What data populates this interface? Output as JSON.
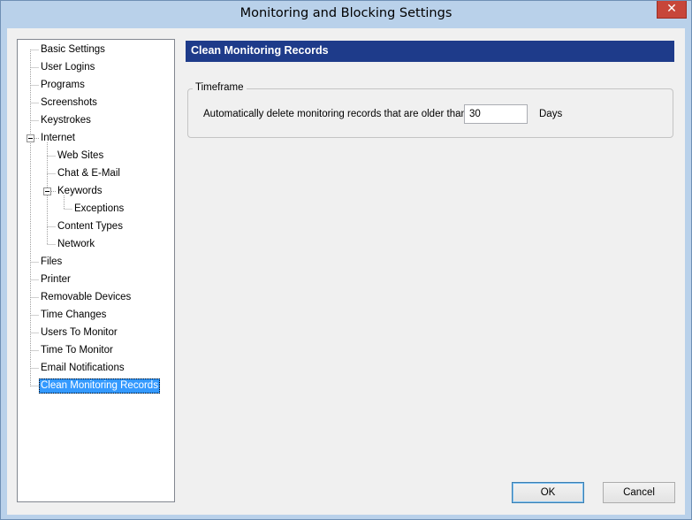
{
  "window": {
    "title": "Monitoring and Blocking Settings",
    "close_glyph": "✕"
  },
  "tree": [
    {
      "label": "Basic Settings",
      "name": "tree-item-basic-settings"
    },
    {
      "label": "User Logins",
      "name": "tree-item-user-logins"
    },
    {
      "label": "Programs",
      "name": "tree-item-programs"
    },
    {
      "label": "Screenshots",
      "name": "tree-item-screenshots"
    },
    {
      "label": "Keystrokes",
      "name": "tree-item-keystrokes"
    },
    {
      "label": "Internet",
      "name": "tree-item-internet",
      "expanded": true
    },
    {
      "label": "Web Sites",
      "name": "tree-item-web-sites"
    },
    {
      "label": "Chat & E-Mail",
      "name": "tree-item-chat-email"
    },
    {
      "label": "Keywords",
      "name": "tree-item-keywords",
      "expanded": true
    },
    {
      "label": "Exceptions",
      "name": "tree-item-exceptions"
    },
    {
      "label": "Content Types",
      "name": "tree-item-content-types"
    },
    {
      "label": "Network",
      "name": "tree-item-network"
    },
    {
      "label": "Files",
      "name": "tree-item-files"
    },
    {
      "label": "Printer",
      "name": "tree-item-printer"
    },
    {
      "label": "Removable Devices",
      "name": "tree-item-removable-devices"
    },
    {
      "label": "Time Changes",
      "name": "tree-item-time-changes"
    },
    {
      "label": "Users To Monitor",
      "name": "tree-item-users-to-monitor"
    },
    {
      "label": "Time To Monitor",
      "name": "tree-item-time-to-monitor"
    },
    {
      "label": "Email Notifications",
      "name": "tree-item-email-notifications"
    },
    {
      "label": "Clean Monitoring Records",
      "name": "tree-item-clean-monitoring-records",
      "selected": true
    }
  ],
  "panel": {
    "header": "Clean Monitoring Records",
    "group_title": "Timeframe",
    "field_label": "Automatically delete monitoring records that are older than:",
    "field_value": "30",
    "unit_label": "Days"
  },
  "buttons": {
    "ok": "OK",
    "cancel": "Cancel"
  },
  "colors": {
    "header_bar": "#1e3b8a",
    "selection": "#3399ff",
    "close_button": "#c7463a"
  }
}
